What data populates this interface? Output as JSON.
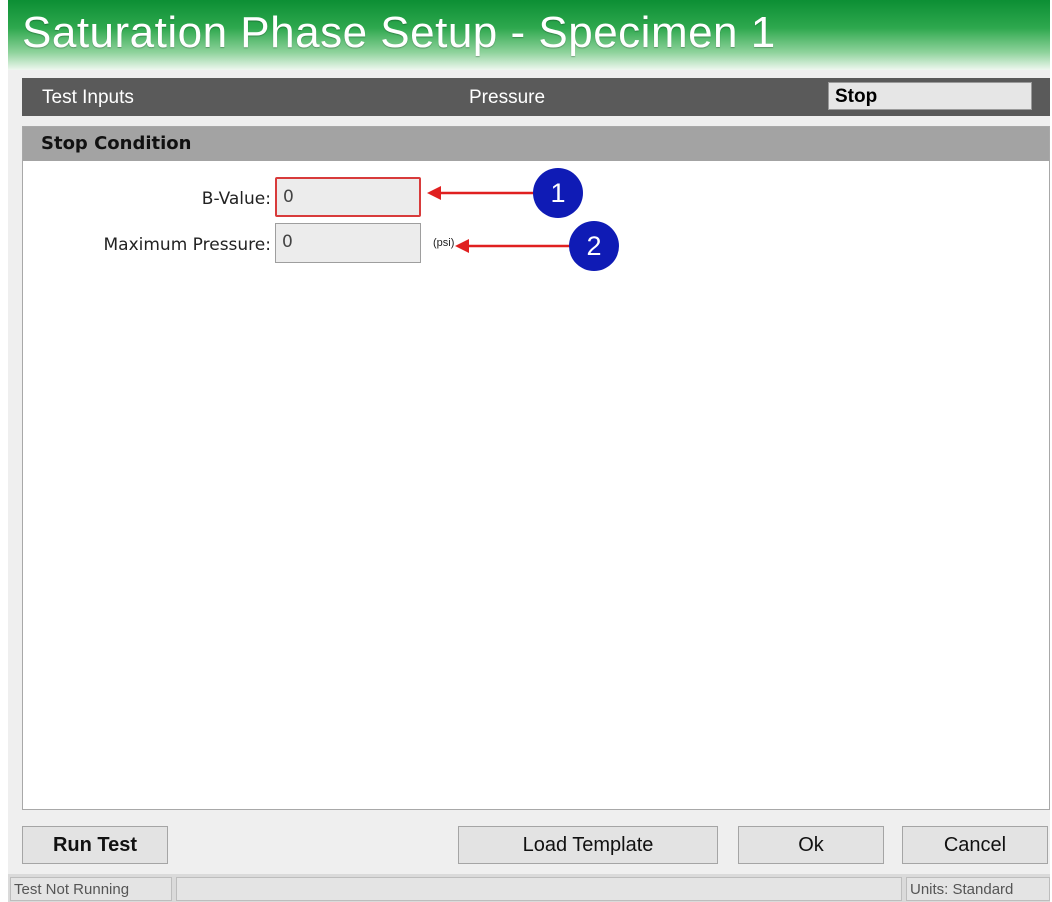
{
  "window": {
    "title": "Saturation Phase Setup - Specimen 1"
  },
  "tabs": [
    {
      "label": "Test Inputs",
      "selected": false
    },
    {
      "label": "Pressure",
      "selected": false
    },
    {
      "label": "Stop",
      "selected": true
    }
  ],
  "stop_condition": {
    "header": "Stop Condition",
    "b_value": {
      "label": "B-Value:",
      "value": "0"
    },
    "max_pressure": {
      "label": "Maximum Pressure:",
      "value": "0",
      "unit": "(psi)"
    }
  },
  "callouts": [
    "1",
    "2"
  ],
  "buttons": {
    "run_test": "Run Test",
    "load_template": "Load Template",
    "ok": "Ok",
    "cancel": "Cancel"
  },
  "status": {
    "left": "Test Not Running",
    "middle": "",
    "right": "Units: Standard"
  },
  "colors": {
    "title_green": "#0c8f34",
    "highlight_red": "#d83b3b",
    "callout_blue": "#0f1bb5",
    "arrow_red": "#e02020"
  }
}
